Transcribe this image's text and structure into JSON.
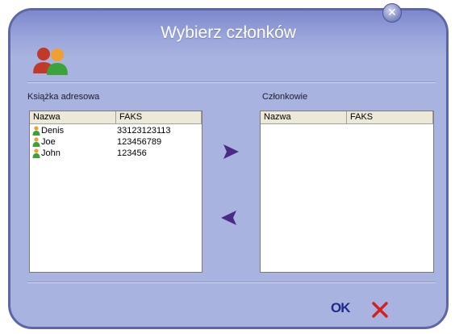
{
  "dialog": {
    "title": "Wybierz członków",
    "close_icon": "close-icon"
  },
  "address_book": {
    "label": "Książka adresowa",
    "columns": [
      "Nazwa",
      "FAKS"
    ],
    "rows": [
      {
        "name": "Denis",
        "fax": "33123123113"
      },
      {
        "name": "Joe",
        "fax": "123456789"
      },
      {
        "name": "John",
        "fax": "123456"
      }
    ]
  },
  "members": {
    "label": "Członkowie",
    "columns": [
      "Nazwa",
      "FAKS"
    ],
    "rows": []
  },
  "buttons": {
    "add_icon": "arrow-right-icon",
    "remove_icon": "arrow-left-icon",
    "ok_label": "OK",
    "cancel_icon": "x-icon"
  },
  "colors": {
    "dialog_bg": "#a9b3df",
    "title_bar": "#7d88cc",
    "arrow": "#4b2a86",
    "ok": "#1e2a8a",
    "cancel": "#d42020"
  }
}
